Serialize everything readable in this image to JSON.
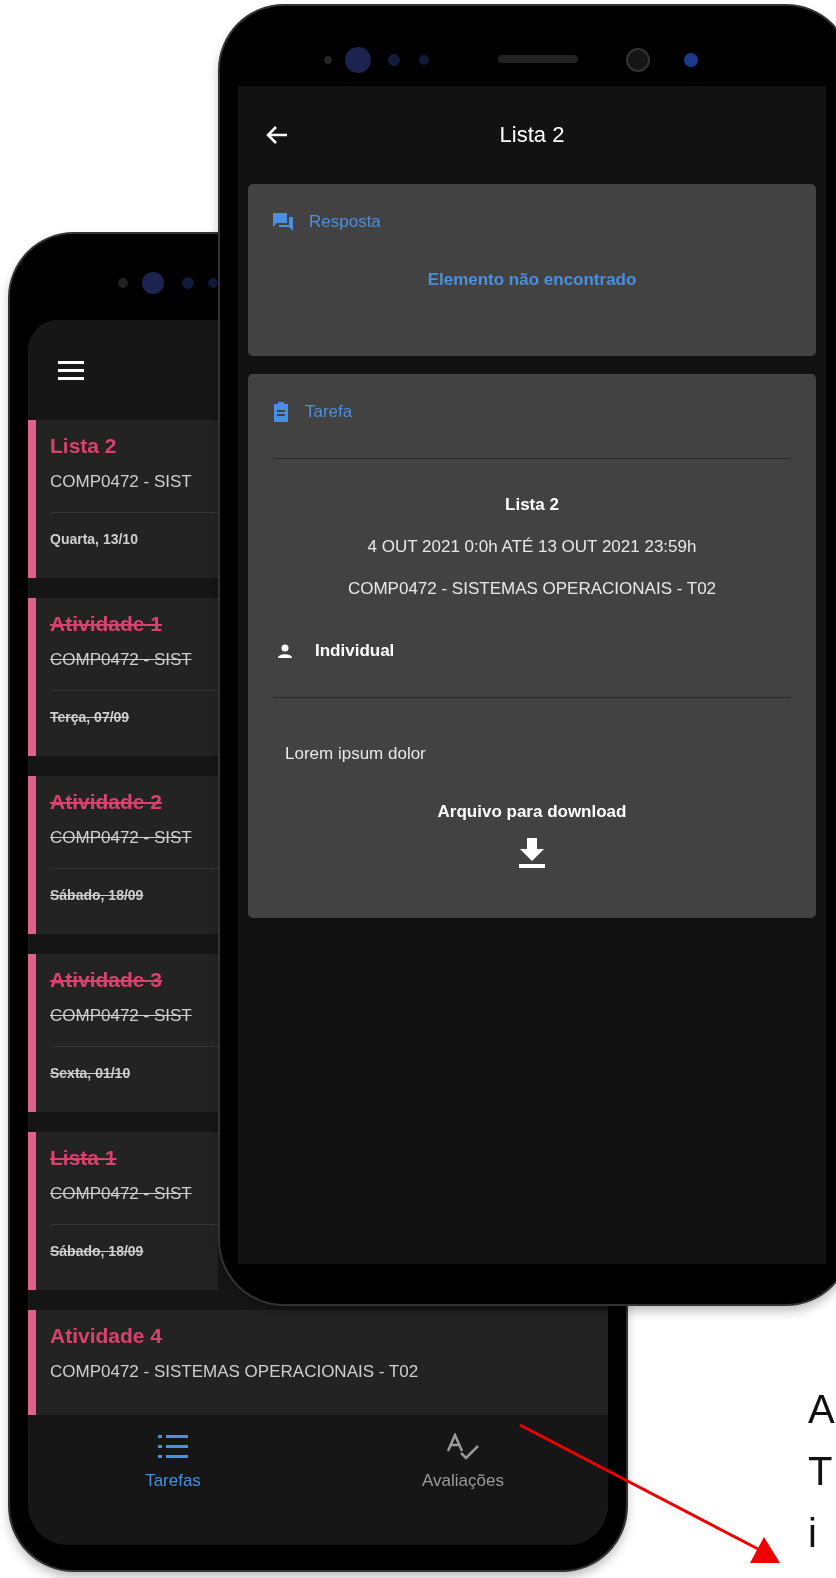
{
  "back_screen": {
    "tasks": [
      {
        "title": "Lista 2",
        "subject": "COMP0472 - SIST",
        "date": "Quarta, 13/10",
        "done": false
      },
      {
        "title": "Atividade 1",
        "subject": "COMP0472 - SIST",
        "date": "Terça, 07/09",
        "done": true
      },
      {
        "title": "Atividade 2",
        "subject": "COMP0472 - SIST",
        "date": "Sábado, 18/09",
        "done": true
      },
      {
        "title": "Atividade 3",
        "subject": "COMP0472 - SIST",
        "date": "Sexta, 01/10",
        "done": true
      },
      {
        "title": "Lista 1",
        "subject": "COMP0472 - SIST",
        "date": "Sábado, 18/09",
        "done": true
      },
      {
        "title": "Atividade 4",
        "subject": "COMP0472 - SISTEMAS OPERACIONAIS - T02",
        "done": false
      }
    ],
    "nav_tabs": [
      {
        "label": "Tarefas",
        "selected": true,
        "kind": "list"
      },
      {
        "label": "Avaliações",
        "selected": false,
        "kind": "grading"
      }
    ]
  },
  "front_screen": {
    "title": "Lista 2",
    "response": {
      "heading": "Resposta",
      "message": "Elemento não encontrado"
    },
    "task": {
      "heading": "Tarefa",
      "name": "Lista 2",
      "period": "4 OUT 2021 0:0h ATÉ 13 OUT 2021 23:59h",
      "subject": "COMP0472 - SISTEMAS OPERACIONAIS - T02",
      "mode": "Individual",
      "description": "Lorem ipsum dolor",
      "download_label": "Arquivo para download"
    }
  },
  "annotation": {
    "lines": [
      "A",
      "T",
      "i"
    ]
  }
}
